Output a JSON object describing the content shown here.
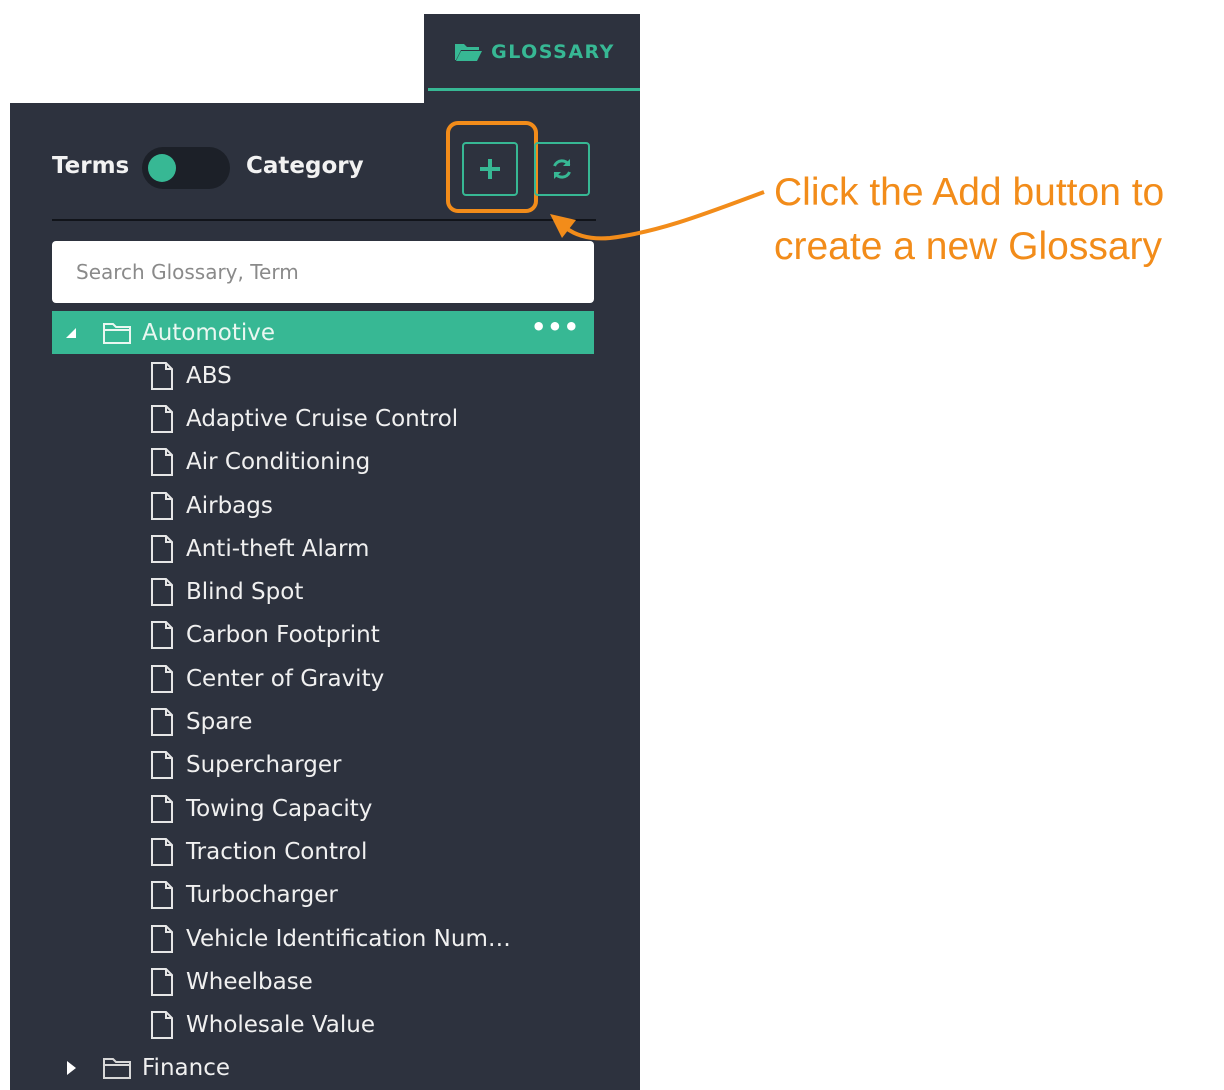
{
  "tab": {
    "label": "GLOSSARY",
    "icon": "folder-open-icon"
  },
  "toggle": {
    "left_label": "Terms",
    "right_label": "Category"
  },
  "buttons": {
    "add_symbol": "+",
    "add_icon": "plus-icon",
    "refresh_icon": "refresh-icon"
  },
  "search": {
    "placeholder": "Search Glossary, Term",
    "value": ""
  },
  "tree": {
    "root": {
      "label": "Automotive",
      "more": "•••",
      "expanded": true
    },
    "terms": [
      "ABS",
      "Adaptive Cruise Control",
      "Air Conditioning",
      "Airbags",
      "Anti-theft Alarm",
      "Blind Spot",
      "Carbon Footprint",
      "Center of Gravity",
      "Spare",
      "Supercharger",
      "Towing Capacity",
      "Traction Control",
      "Turbocharger",
      "Vehicle Identification Num…",
      "Wheelbase",
      "Wholesale Value"
    ],
    "collapsed": {
      "label": "Finance"
    }
  },
  "callout": {
    "line1": "Click the Add button to",
    "line2": "create a new Glossary"
  },
  "colors": {
    "accent": "#37b894",
    "panel": "#2d323e",
    "callout": "#f28c1a"
  }
}
